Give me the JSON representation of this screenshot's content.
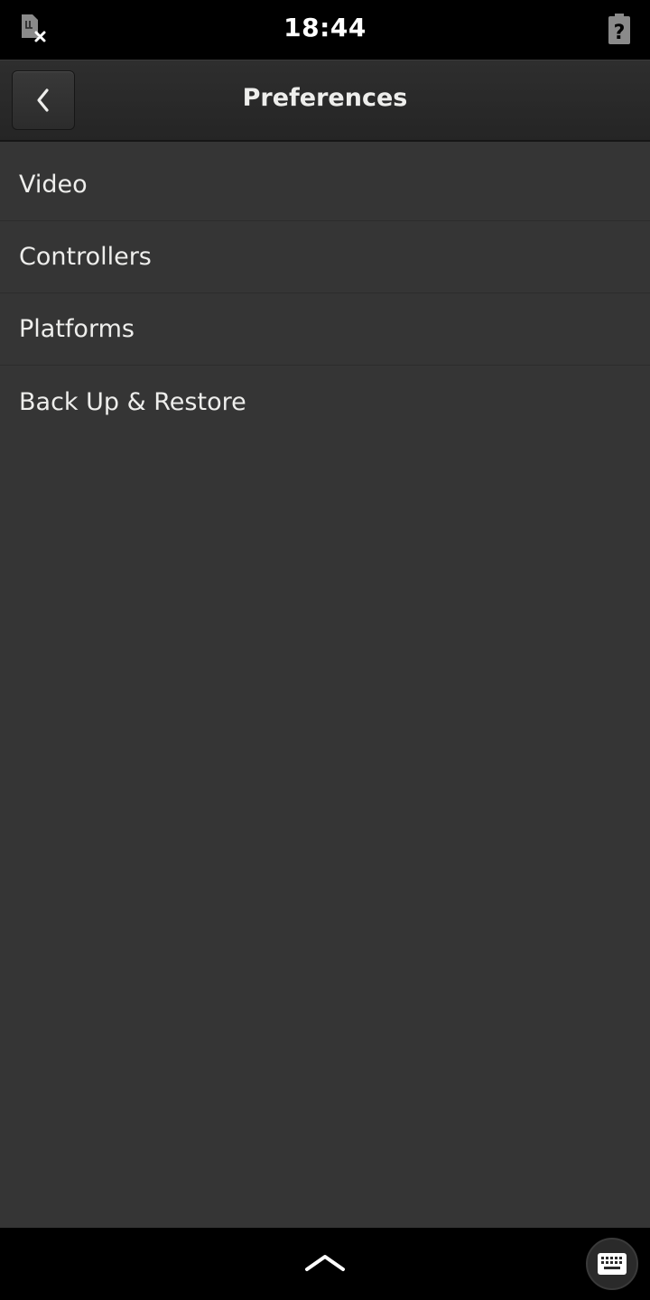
{
  "status_bar": {
    "time": "18:44",
    "left_icon": "sim-card-missing-icon",
    "right_icon": "battery-unknown-icon"
  },
  "header": {
    "title": "Preferences",
    "back_icon": "chevron-left-icon"
  },
  "preferences": {
    "items": [
      {
        "label": "Video"
      },
      {
        "label": "Controllers"
      },
      {
        "label": "Platforms"
      },
      {
        "label": "Back Up & Restore"
      }
    ]
  },
  "bottom_bar": {
    "handle_icon": "chevron-up-icon",
    "keyboard_icon": "keyboard-icon"
  },
  "colors": {
    "content_background": "#353535",
    "header_background": "#2a2a2a",
    "text": "#eeeeec",
    "system_bar": "#000000"
  }
}
